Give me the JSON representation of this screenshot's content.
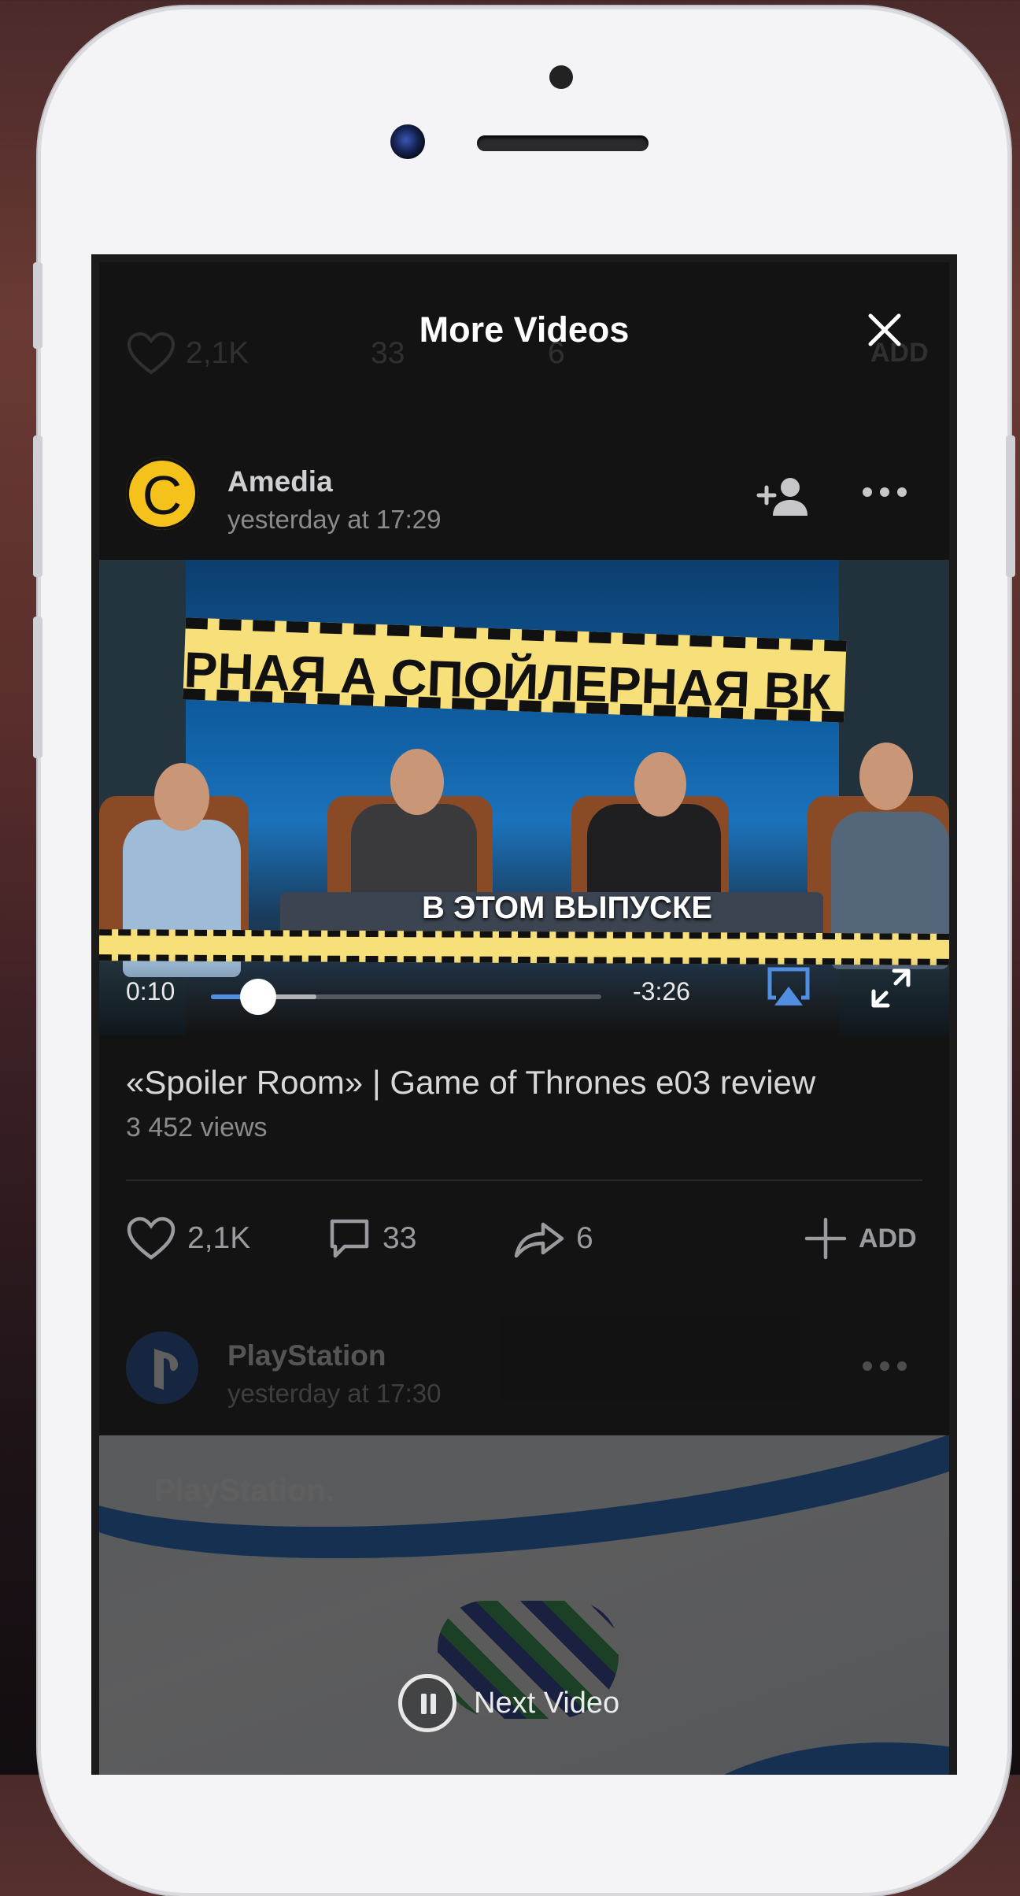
{
  "header": {
    "title": "More Videos",
    "close_label": "close"
  },
  "ghost_row": {
    "likes": "2,1K",
    "comments": "33",
    "shares": "6",
    "add": "ADD"
  },
  "post": {
    "author": "Amedia",
    "avatar_letter": "C",
    "time": "yesterday at 17:29",
    "video": {
      "tape_text": "РНАЯ  А  СПОЙЛЕРНАЯ  ВК  СПОЙЛ",
      "caption": "В ЭТОМ ВЫПУСКЕ",
      "current_time": "0:10",
      "remaining_time": "-3:26",
      "progress_fraction": 0.12,
      "buffered_fraction": 0.27
    },
    "title": "«Spoiler Room» |  Game of Thrones e03 review",
    "views": "3 452 views",
    "actions": {
      "likes": "2,1K",
      "comments": "33",
      "shares": "6",
      "add": "ADD"
    }
  },
  "next_post": {
    "author": "PlayStation",
    "time": "yesterday at 17:30",
    "banner_logo": "PlayStation."
  },
  "next_video_label": "Next Video",
  "colors": {
    "accent": "#4f8ee0",
    "background": "#131313",
    "avatar": "#f5c21b"
  }
}
